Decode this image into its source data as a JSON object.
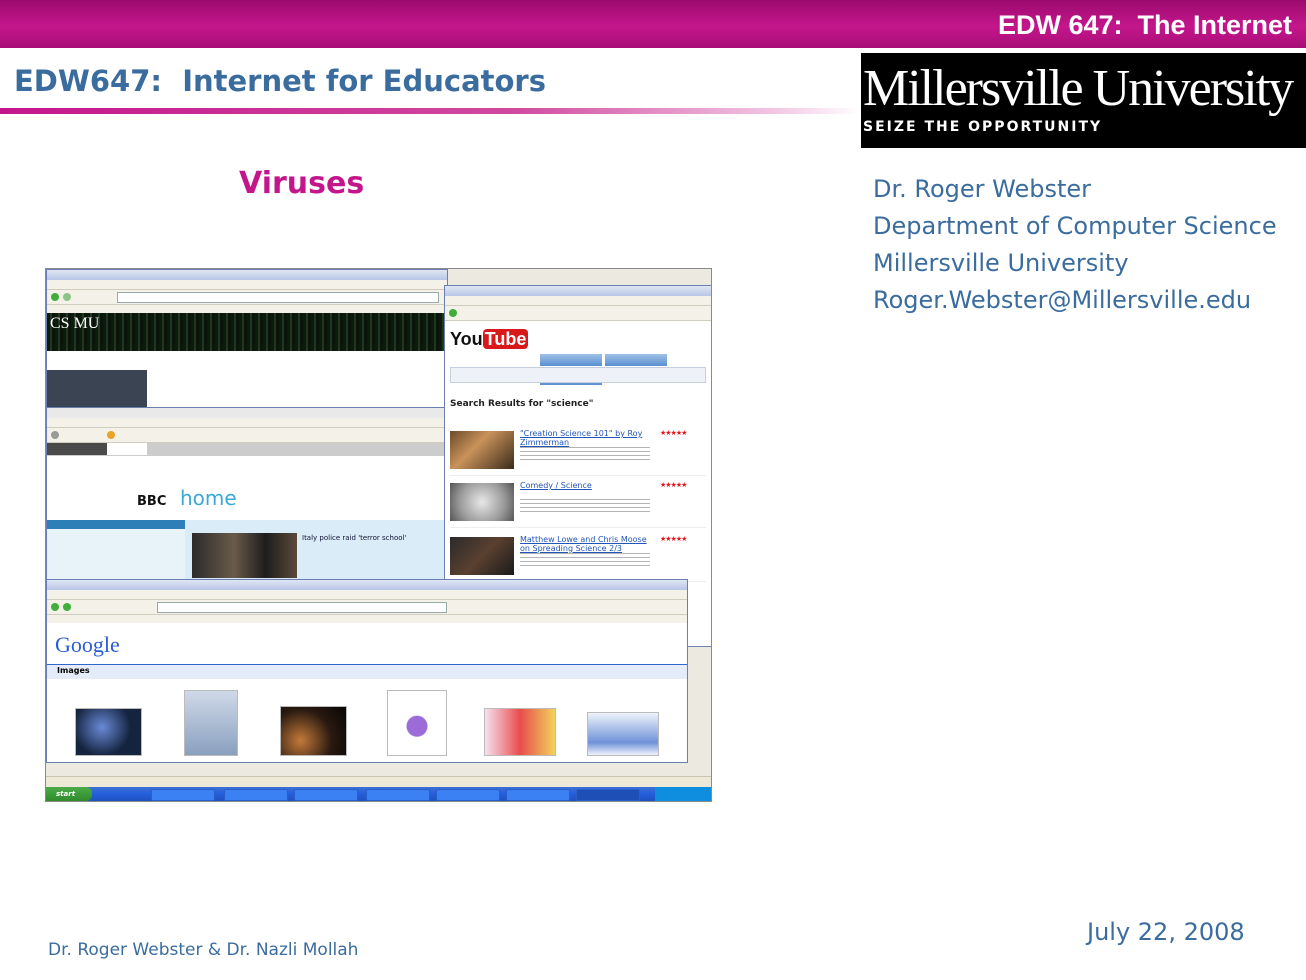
{
  "header": {
    "right_title": "EDW 647:  The Internet"
  },
  "course": {
    "title": "EDW647:  Internet for Educators"
  },
  "logo": {
    "name": "Millersville University",
    "tagline": "SEIZE THE OPPORTUNITY"
  },
  "slide": {
    "title": "Viruses"
  },
  "contact": {
    "name": "Dr. Roger Webster",
    "department": "Department of Computer Science",
    "university": "Millersville University",
    "email": "Roger.Webster@Millersville.edu"
  },
  "date": "July 22, 2008",
  "footer": {
    "authors": "Dr. Roger Webster & Dr. Nazli Mollah"
  },
  "screenshot": {
    "cs_logo": "CS MU",
    "bbc_logo": "BBC",
    "bbc_home": "home",
    "bbc_headline": "Italy police raid 'terror school'",
    "yt_logo_you": "You",
    "yt_logo_tube": "Tube",
    "yt_search_heading": "Search Results for \"science\"",
    "yt_results": [
      "\"Creation Science 101\" by Roy Zimmerman",
      "Comedy / Science",
      "Matthew Lowe and Chris Moose on Spreading Science 2/3"
    ],
    "google_logo": "Google",
    "google_images_label": "Images",
    "start_label": "start"
  },
  "colors": {
    "accent": "#c4168c",
    "text_blue": "#3a6c9e",
    "logo_bg": "#000000"
  }
}
